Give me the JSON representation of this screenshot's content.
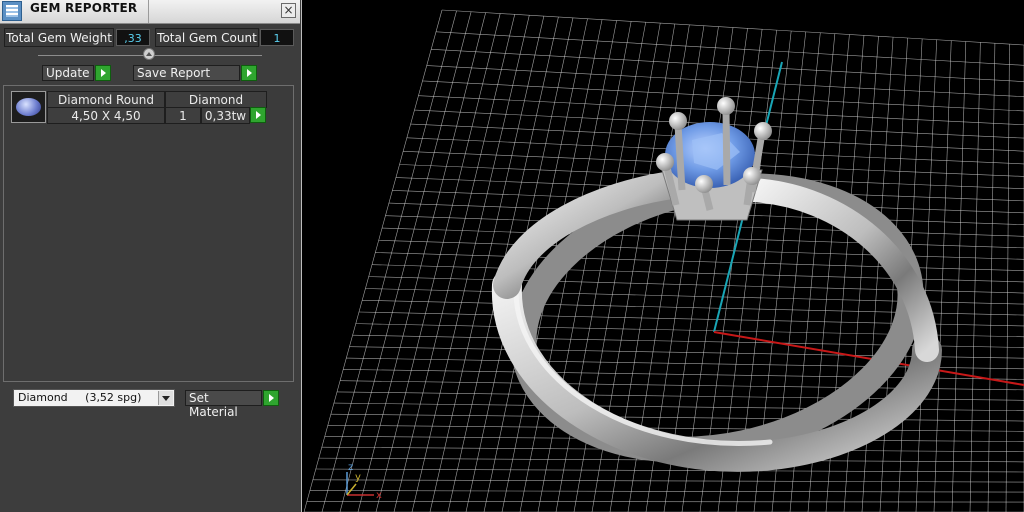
{
  "window": {
    "title": "GEM REPORTER",
    "close_glyph": "×"
  },
  "summary": {
    "total_weight_label": "Total Gem Weight",
    "total_weight_value": ",33",
    "total_count_label": "Total Gem Count",
    "total_count_value": "1"
  },
  "actions": {
    "update_label": "Update",
    "save_report_label": "Save Report"
  },
  "gem_list": {
    "rows": [
      {
        "shape": "Diamond Round",
        "size": "4,50 X 4,50",
        "material": "Diamond",
        "count": "1",
        "weight": "0,33tw"
      }
    ]
  },
  "material": {
    "selected": "Diamond     (3,52 spg)",
    "set_label": "Set Material"
  },
  "viewport": {
    "axis_labels": {
      "z": "z",
      "y": "y",
      "x": "x"
    },
    "colors": {
      "grid": "#d8d8d8",
      "axis_x": "#c81818",
      "axis_z": "#19a6b6",
      "gem": "#5f8fe0",
      "metal": "#cfcfcf"
    }
  }
}
